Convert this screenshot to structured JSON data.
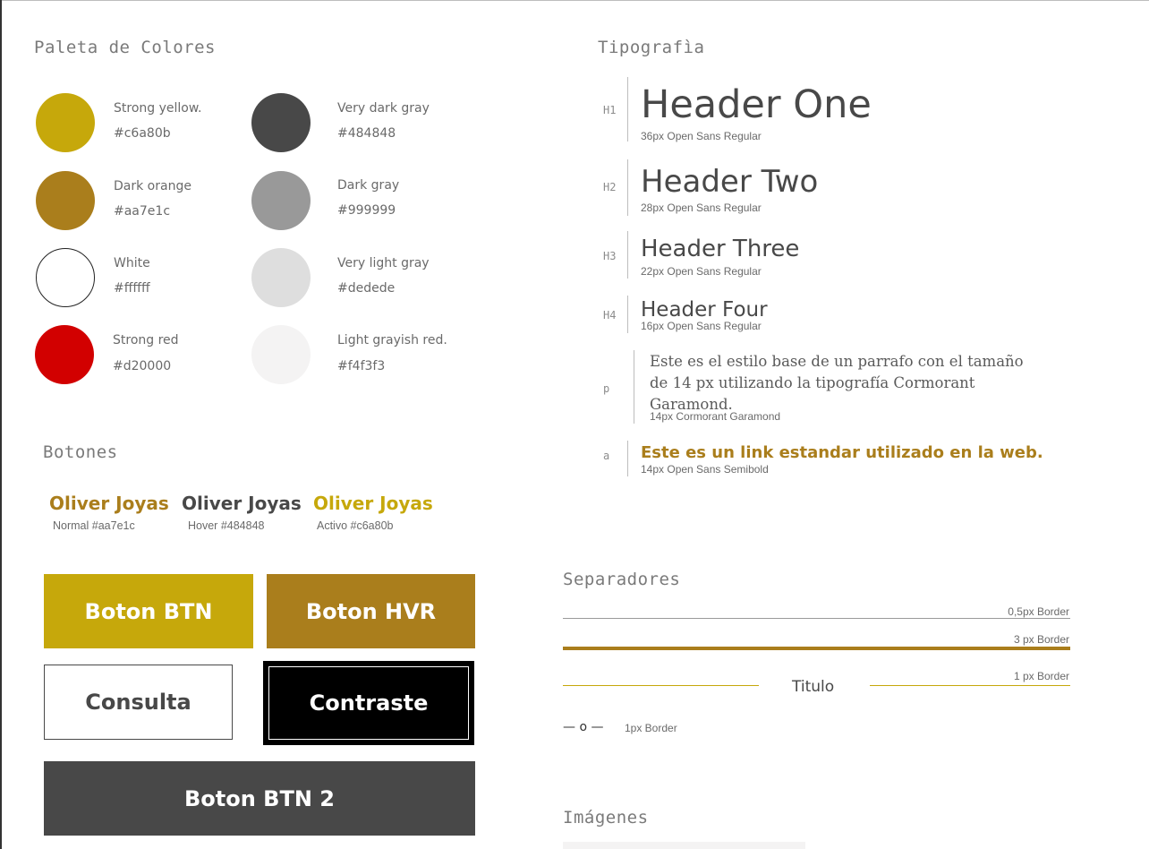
{
  "palette": {
    "title": "Paleta de Colores",
    "colors": [
      {
        "name": "Strong yellow.",
        "hex": "#c6a80b",
        "fill": "#c6a80b"
      },
      {
        "name": "Dark orange",
        "hex": "#aa7e1c",
        "fill": "#aa7e1c"
      },
      {
        "name": "White",
        "hex": "#ffffff",
        "fill": "#ffffff"
      },
      {
        "name": "Strong red",
        "hex": "#d20000",
        "fill": "#d20000"
      },
      {
        "name": "Very dark gray",
        "hex": "#484848",
        "fill": "#484848"
      },
      {
        "name": "Dark gray",
        "hex": "#999999",
        "fill": "#999999"
      },
      {
        "name": "Very light gray",
        "hex": "#dedede",
        "fill": "#dedede"
      },
      {
        "name": "Light grayish red.",
        "hex": "#f4f3f3",
        "fill": "#f4f3f3"
      }
    ]
  },
  "typography": {
    "title": "Tipografìa",
    "h1": {
      "tag": "H1",
      "sample": "Header One",
      "meta": "36px Open Sans Regular"
    },
    "h2": {
      "tag": "H2",
      "sample": "Header Two",
      "meta": "28px Open Sans Regular"
    },
    "h3": {
      "tag": "H3",
      "sample": "Header Three",
      "meta": "22px Open Sans Regular"
    },
    "h4": {
      "tag": "H4",
      "sample": "Header Four",
      "meta": "16px Open Sans Regular"
    },
    "p": {
      "tag": "p",
      "sample": "Este es el estilo base de un parrafo con el tamaño de 14 px utilizando la tipografía Cormorant Garamond.",
      "meta": "14px Cormorant Garamond"
    },
    "a": {
      "tag": "a",
      "sample": "Este es un link estandar utilizado en la web.",
      "meta": "14px Open Sans Semibold"
    }
  },
  "buttons": {
    "title": "Botones",
    "text_buttons": [
      {
        "label": "Oliver Joyas",
        "meta": "Normal #aa7e1c",
        "color": "#aa7e1c"
      },
      {
        "label": "Oliver Joyas",
        "meta": "Hover #484848",
        "color": "#484848"
      },
      {
        "label": "Oliver Joyas",
        "meta": "Activo #c6a80b",
        "color": "#c6a80b"
      }
    ],
    "block": {
      "btn": "Boton BTN",
      "hvr": "Boton HVR",
      "consulta": "Consulta",
      "contraste": "Contraste",
      "btn2": "Boton BTN 2"
    }
  },
  "separators": {
    "title": "Separadores",
    "thin_label": "0,5px Border",
    "thick_label": "3 px Border",
    "titled_label": "1 px Border",
    "titled_text": "Titulo",
    "mini_symbol": "— o —",
    "mini_label": "1px Border"
  },
  "images": {
    "title": "Imágenes"
  }
}
